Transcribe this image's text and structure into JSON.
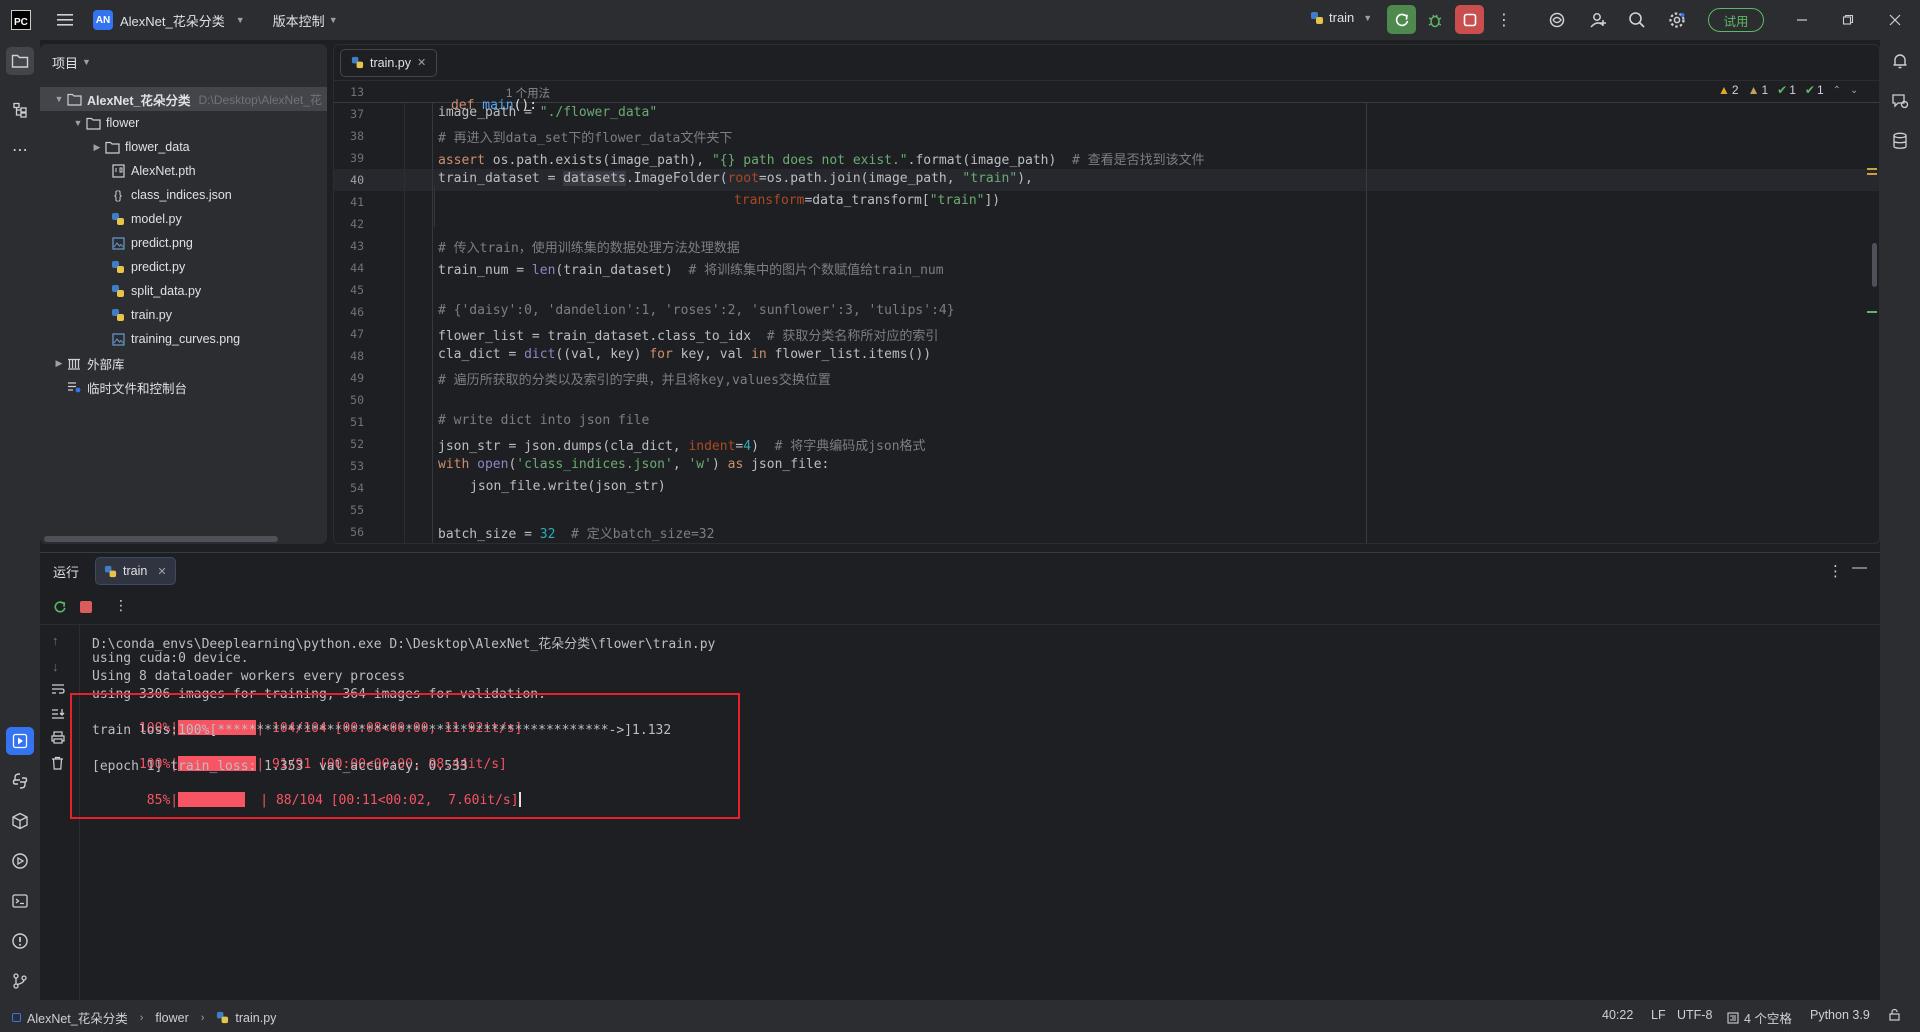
{
  "titlebar": {
    "logo": "PC",
    "project_badge": "AN",
    "project_name": "AlexNet_花朵分类",
    "vcs_label": "版本控制",
    "run_config": "train",
    "trial_button": "试用"
  },
  "project_panel": {
    "title": "项目",
    "tree": [
      {
        "label": "AlexNet_花朵分类",
        "hint": "D:\\Desktop\\AlexNet_花",
        "type": "root-folder"
      },
      {
        "label": "flower",
        "type": "folder"
      },
      {
        "label": "flower_data",
        "type": "folder"
      },
      {
        "label": "AlexNet.pth",
        "type": "binary"
      },
      {
        "label": "class_indices.json",
        "type": "json"
      },
      {
        "label": "model.py",
        "type": "python"
      },
      {
        "label": "predict.png",
        "type": "image"
      },
      {
        "label": "predict.py",
        "type": "python"
      },
      {
        "label": "split_data.py",
        "type": "python"
      },
      {
        "label": "train.py",
        "type": "python"
      },
      {
        "label": "training_curves.png",
        "type": "image"
      },
      {
        "label": "外部库",
        "type": "library"
      },
      {
        "label": "临时文件和控制台",
        "type": "scratches"
      }
    ]
  },
  "editor": {
    "tab": "train.py",
    "sticky_line": "13",
    "sticky_def": "def ",
    "sticky_fn": "main",
    "sticky_rest": "():",
    "sticky_usage": "1 个用法",
    "inspections": {
      "warn_major": "2",
      "warn_minor": "1",
      "ok_a": "1",
      "ok_b": "1"
    },
    "line_numbers": [
      "37",
      "38",
      "39",
      "40",
      "41",
      "42",
      "43",
      "44",
      "45",
      "46",
      "47",
      "48",
      "49",
      "50",
      "51",
      "52",
      "53",
      "54",
      "55",
      "56"
    ],
    "code": {
      "l37": {
        "a": "image_path = ",
        "s": "\"./flower_data\""
      },
      "l38": "# 再进入到data_set下的flower_data文件夹下",
      "l39": {
        "kw": "assert ",
        "a": "os.path.exists(image_path), ",
        "s": "\"{} path does not exist.\"",
        "b": ".format(image_path)  ",
        "c": "# 查看是否找到该文件"
      },
      "l40": {
        "a": "train_dataset = ",
        "w": "datasets",
        "b": ".ImageFolder(",
        "p": "root",
        "c": "=os.path.join(image_path, ",
        "s": "\"train\"",
        "d": "),"
      },
      "l41": {
        "p": "transform",
        "a": "=data_transform[",
        "s": "\"train\"",
        "b": "])"
      },
      "l43": "# 传入train，使用训练集的数据处理方法处理数据",
      "l44": {
        "a": "train_num = ",
        "bi": "len",
        "b": "(train_dataset)  ",
        "c": "# 将训练集中的图片个数赋值给train_num"
      },
      "l46": "# {'daisy':0, 'dandelion':1, 'roses':2, 'sunflower':3, 'tulips':4}",
      "l47": {
        "a": "flower_list = train_dataset.class_to_idx  ",
        "c": "# 获取分类名称所对应的索引"
      },
      "l48": {
        "a": "cla_dict = ",
        "bi": "dict",
        "b": "((val, key) ",
        "kw1": "for",
        "c": " key, val ",
        "kw2": "in",
        "d": " flower_list.items())"
      },
      "l49": "# 遍历所获取的分类以及索引的字典，并且将key,values交换位置",
      "l51": "# write dict into json file",
      "l52": {
        "a": "json_str = json.dumps(cla_dict, ",
        "p": "indent",
        "b": "=",
        "n": "4",
        "c": ")  ",
        "cm": "# 将字典编码成json格式"
      },
      "l53": {
        "kw": "with ",
        "bi": "open",
        "a": "(",
        "s1": "'class_indices.json'",
        "b": ", ",
        "s2": "'w'",
        "c": ") ",
        "kw2": "as",
        "d": " json_file:"
      },
      "l54": "json_file.write(json_str)",
      "l56": {
        "a": "batch_size = ",
        "n": "32",
        "c": "  # 定义batch_size=32"
      }
    }
  },
  "run_panel": {
    "title": "运行",
    "tab": "train",
    "lines": [
      "D:\\conda_envs\\Deeplearning\\python.exe D:\\Desktop\\AlexNet_花朵分类\\flower\\train.py",
      "using cuda:0 device.",
      "Using 8 dataloader workers every process",
      "using 3306 images for training, 364 images for validation."
    ],
    "progress_1": {
      "pct": "100%|",
      "rest": "| 104/104 [00:08<00:00, 11.92it/s]",
      "fill": 1.0
    },
    "train_loss_line": "train loss:100%[**************************************************->]1.132",
    "progress_2": {
      "pct": "100%|",
      "rest": "| 91/91 [00:00<00:00, 98.44it/s]",
      "fill": 1.0
    },
    "epoch_line": "[epoch 1] train_loss: 1.353  val_accuracy: 0.533",
    "progress_3": {
      "pct": " 85%|",
      "rest": "  | 88/104 [00:11<00:02,  7.60it/s]",
      "fill": 0.85
    }
  },
  "statusbar": {
    "breadcrumb": [
      "AlexNet_花朵分类",
      "flower",
      "train.py"
    ],
    "position": "40:22",
    "line_sep": "LF",
    "encoding": "UTF-8",
    "indent": "4 个空格",
    "interpreter": "Python 3.9"
  },
  "colors": {
    "accent": "#3574f0",
    "error": "#f75464",
    "highlight_box": "#e5222b",
    "run_green": "#4e8a4d",
    "stop_red": "#c94f4f"
  }
}
